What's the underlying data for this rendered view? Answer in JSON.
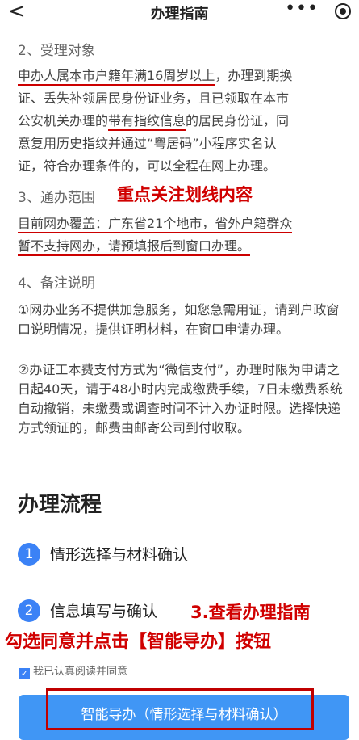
{
  "header": {
    "back_label": "<",
    "title": "办理指南",
    "more_label": "•••",
    "target_label": ""
  },
  "sections": {
    "target": {
      "title": "2、受理对象",
      "line1_ul": "申办人属本市户籍年满16周岁以上",
      "line1_rest": "，办理到期换",
      "line2": "证、丢失补领居民身份证业务，且已领取在本市",
      "line3_a": "公安机关办理的",
      "line3_ul": "带有指纹信息",
      "line3_b": "的居民身份证，同",
      "line4": "意复用历史指纹并通过“粤居码”小程序实名认",
      "line5": "证，符合办理条件的，可以全程在网上办理。"
    },
    "scope": {
      "title": "3、通办范围",
      "line1": "目前网办覆盖：广东省21个地市，省外户籍群众",
      "line2": "暂不支持网办，请预填报后到窗口办理。"
    },
    "notes": {
      "title": "4、备注说明",
      "p1": "①网办业务不提供加急服务，如您急需用证，请到户政窗口说明情况，提供证明材料，在窗口申请办理。",
      "p2": "②办证工本费支付方式为“微信支付”，办理时限为申请之日起40天，请于48小时内完成缴费手续，7日未缴费系统自动撤销，未缴费或调查时间不计入办证时限。选择快递方式领证的，邮费由邮寄公司到付收取。"
    }
  },
  "annotations": {
    "focus": "重点关注划线内容",
    "step3": "3.查看办理指南",
    "click": "勾选同意并点击【智能导办】按钮"
  },
  "flow": {
    "title": "办理流程",
    "steps": [
      {
        "num": "1",
        "label": "情形选择与材料确认"
      },
      {
        "num": "2",
        "label": "信息填写与确认"
      }
    ]
  },
  "agree": {
    "checked": true,
    "label": "我已认真阅读并同意"
  },
  "primary_button": {
    "label": "智能导办（情形选择与材料确认）"
  },
  "colors": {
    "accent": "#4096f5",
    "step_circle": "#3b82f6",
    "annotation": "#d00000"
  }
}
